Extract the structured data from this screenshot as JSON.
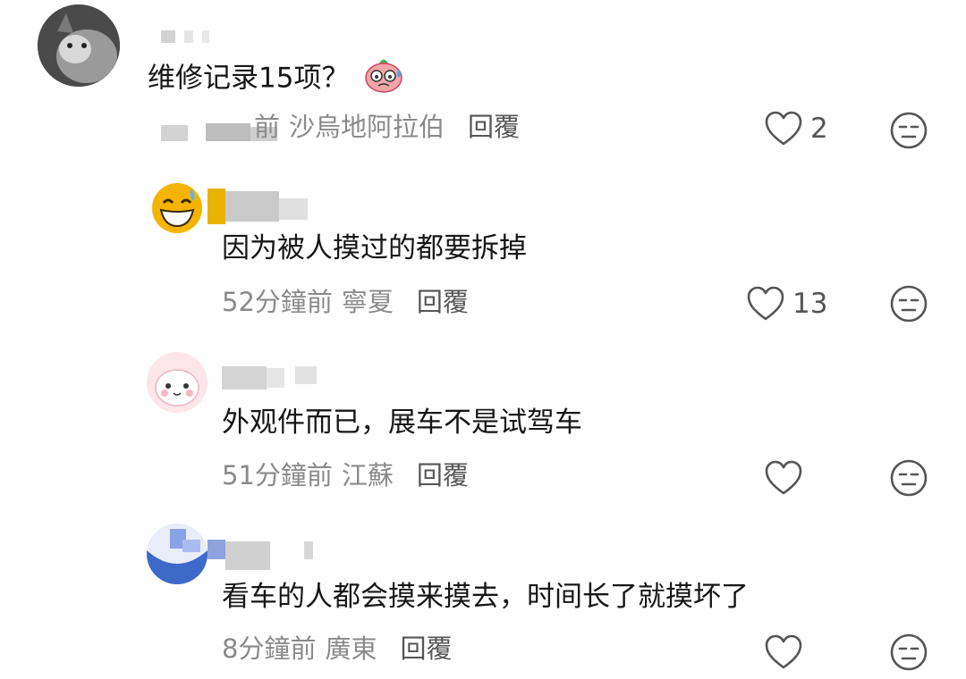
{
  "comments": [
    {
      "text": "维修记录15项？",
      "time": "前",
      "location": "沙烏地阿拉伯",
      "reply": "回覆",
      "likes": "2"
    },
    {
      "text": "因为被人摸过的都要拆掉",
      "time": "52分鐘前",
      "location": "寧夏",
      "reply": "回覆",
      "likes": "13"
    },
    {
      "text": "外观件而已，展车不是试驾车",
      "time": "51分鐘前",
      "location": "江蘇",
      "reply": "回覆",
      "likes": ""
    },
    {
      "text": "看车的人都会摸来摸去，时间长了就摸坏了",
      "time": "8分鐘前",
      "location": "廣東",
      "reply": "回覆",
      "likes": ""
    }
  ],
  "icons": {
    "like": "heart-outline-icon",
    "dislike": "meh-face-icon",
    "emoji": "sweat-face-emoji"
  },
  "colors": {
    "text": "#161616",
    "meta": "#8a8a8a",
    "icon": "#555555"
  }
}
